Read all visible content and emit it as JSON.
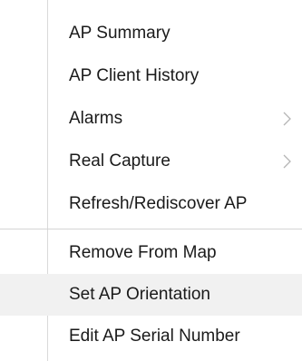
{
  "menu": {
    "groups": [
      {
        "items": [
          {
            "label": "AP Summary",
            "has_submenu": false
          },
          {
            "label": "AP Client History",
            "has_submenu": false
          },
          {
            "label": "Alarms",
            "has_submenu": true,
            "submenu_icon": "chevron-right-icon"
          },
          {
            "label": "Real Capture",
            "has_submenu": true,
            "submenu_icon": "chevron-right-icon"
          },
          {
            "label": "Refresh/Rediscover AP",
            "has_submenu": false
          }
        ]
      },
      {
        "items": [
          {
            "label": "Remove From Map",
            "has_submenu": false
          },
          {
            "label": "Set AP Orientation",
            "has_submenu": false,
            "highlighted": true
          },
          {
            "label": "Edit AP Serial Number",
            "has_submenu": false
          }
        ]
      }
    ],
    "colors": {
      "highlight_background": "#f1f1f1",
      "text": "#1a1a1a",
      "separator": "#d4d4d4",
      "chevron": "#b5b5b5"
    }
  }
}
